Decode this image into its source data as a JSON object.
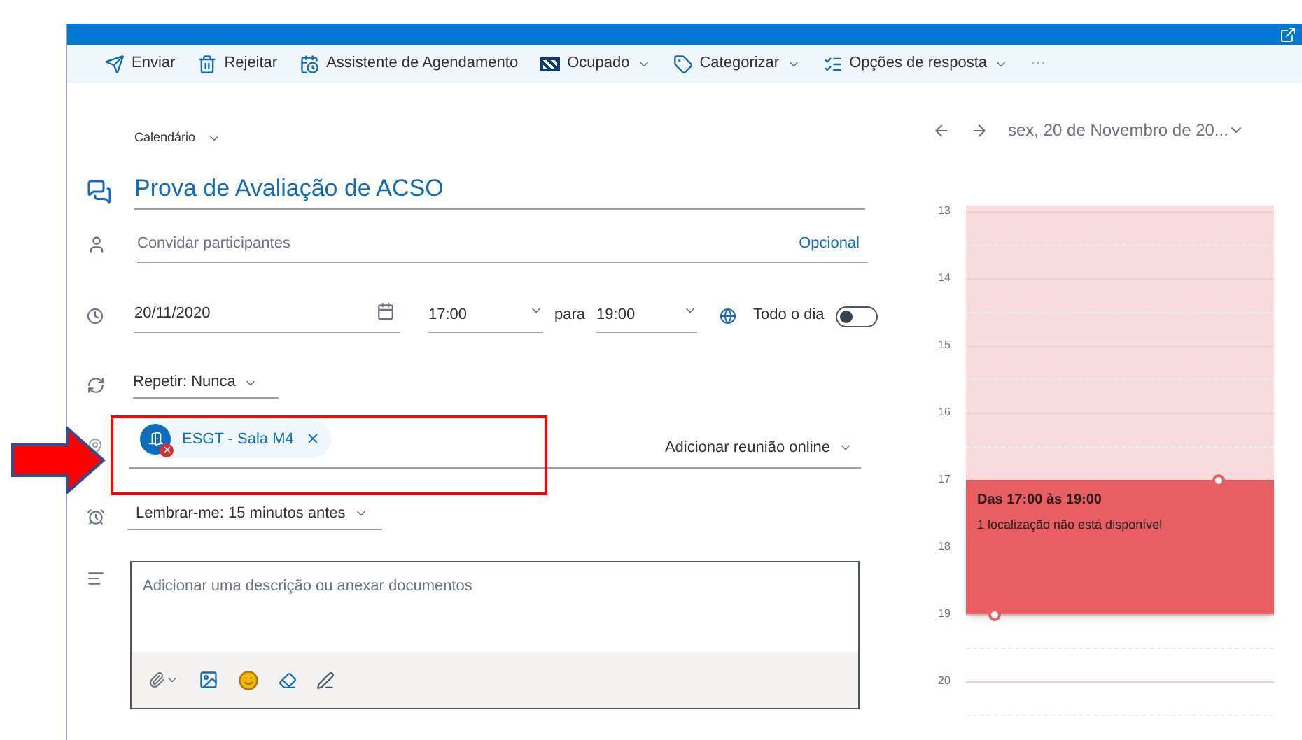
{
  "toolbar": [
    {
      "label": "Enviar",
      "kind": "send",
      "dropdown": false
    },
    {
      "label": "Rejeitar",
      "kind": "discard",
      "dropdown": false
    },
    {
      "label": "Assistente de Agendamento",
      "kind": "scheduler",
      "dropdown": false
    },
    {
      "label": "Ocupado",
      "kind": "busy",
      "dropdown": true
    },
    {
      "label": "Categorizar",
      "kind": "tag",
      "dropdown": true
    },
    {
      "label": "Opções de resposta",
      "kind": "options",
      "dropdown": true
    },
    {
      "label": "···",
      "kind": "more",
      "dropdown": false
    }
  ],
  "calendar_select": "Calendário",
  "title": "Prova de Avaliação de ACSO",
  "attendees": {
    "placeholder": "Convidar participantes",
    "link": "Opcional"
  },
  "date": "20/11/2020",
  "start": "17:00",
  "to_label": "para",
  "end": "19:00",
  "all_day": {
    "label": "Todo o dia",
    "on": false
  },
  "repeat": "Repetir: Nunca",
  "location": {
    "chip": "ESGT - Sala M4",
    "unavailable": true,
    "online": "Adicionar reunião online"
  },
  "reminder": "Lembrar-me: 15 minutos antes",
  "description": {
    "placeholder": "Adicionar uma descrição ou anexar documentos"
  },
  "day_view": {
    "date": "sex, 20 de Novembro de 20...",
    "hours": [
      "13",
      "14",
      "15",
      "16",
      "17",
      "18",
      "19",
      "20"
    ],
    "event": {
      "time": "Das 17:00 às 19:00",
      "note": "1 localização não está disponível"
    }
  }
}
